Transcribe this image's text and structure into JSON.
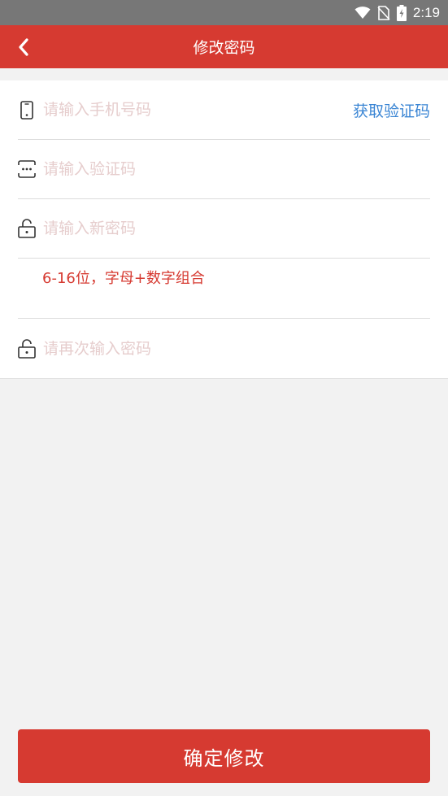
{
  "status_bar": {
    "time": "2:19",
    "icons": [
      "wifi-icon",
      "no-sim-icon",
      "battery-charging-icon"
    ]
  },
  "app_bar": {
    "title": "修改密码",
    "back_icon": "chevron-left-icon"
  },
  "form": {
    "phone": {
      "placeholder": "请输入手机号码",
      "value": "",
      "icon": "phone-icon"
    },
    "get_code_label": "获取验证码",
    "code": {
      "placeholder": "请输入验证码",
      "value": "",
      "icon": "message-icon"
    },
    "new_password": {
      "placeholder": "请输入新密码",
      "value": "",
      "icon": "unlock-icon"
    },
    "password_hint": "6-16位，字母+数字组合",
    "confirm_password": {
      "placeholder": "请再次输入密码",
      "value": "",
      "icon": "unlock-icon"
    }
  },
  "confirm_button": "确定修改",
  "colors": {
    "primary": "#d63a31",
    "link": "#3a85d4",
    "placeholder": "#e6cdcd",
    "background": "#f2f2f2",
    "status_bar": "#777777"
  }
}
